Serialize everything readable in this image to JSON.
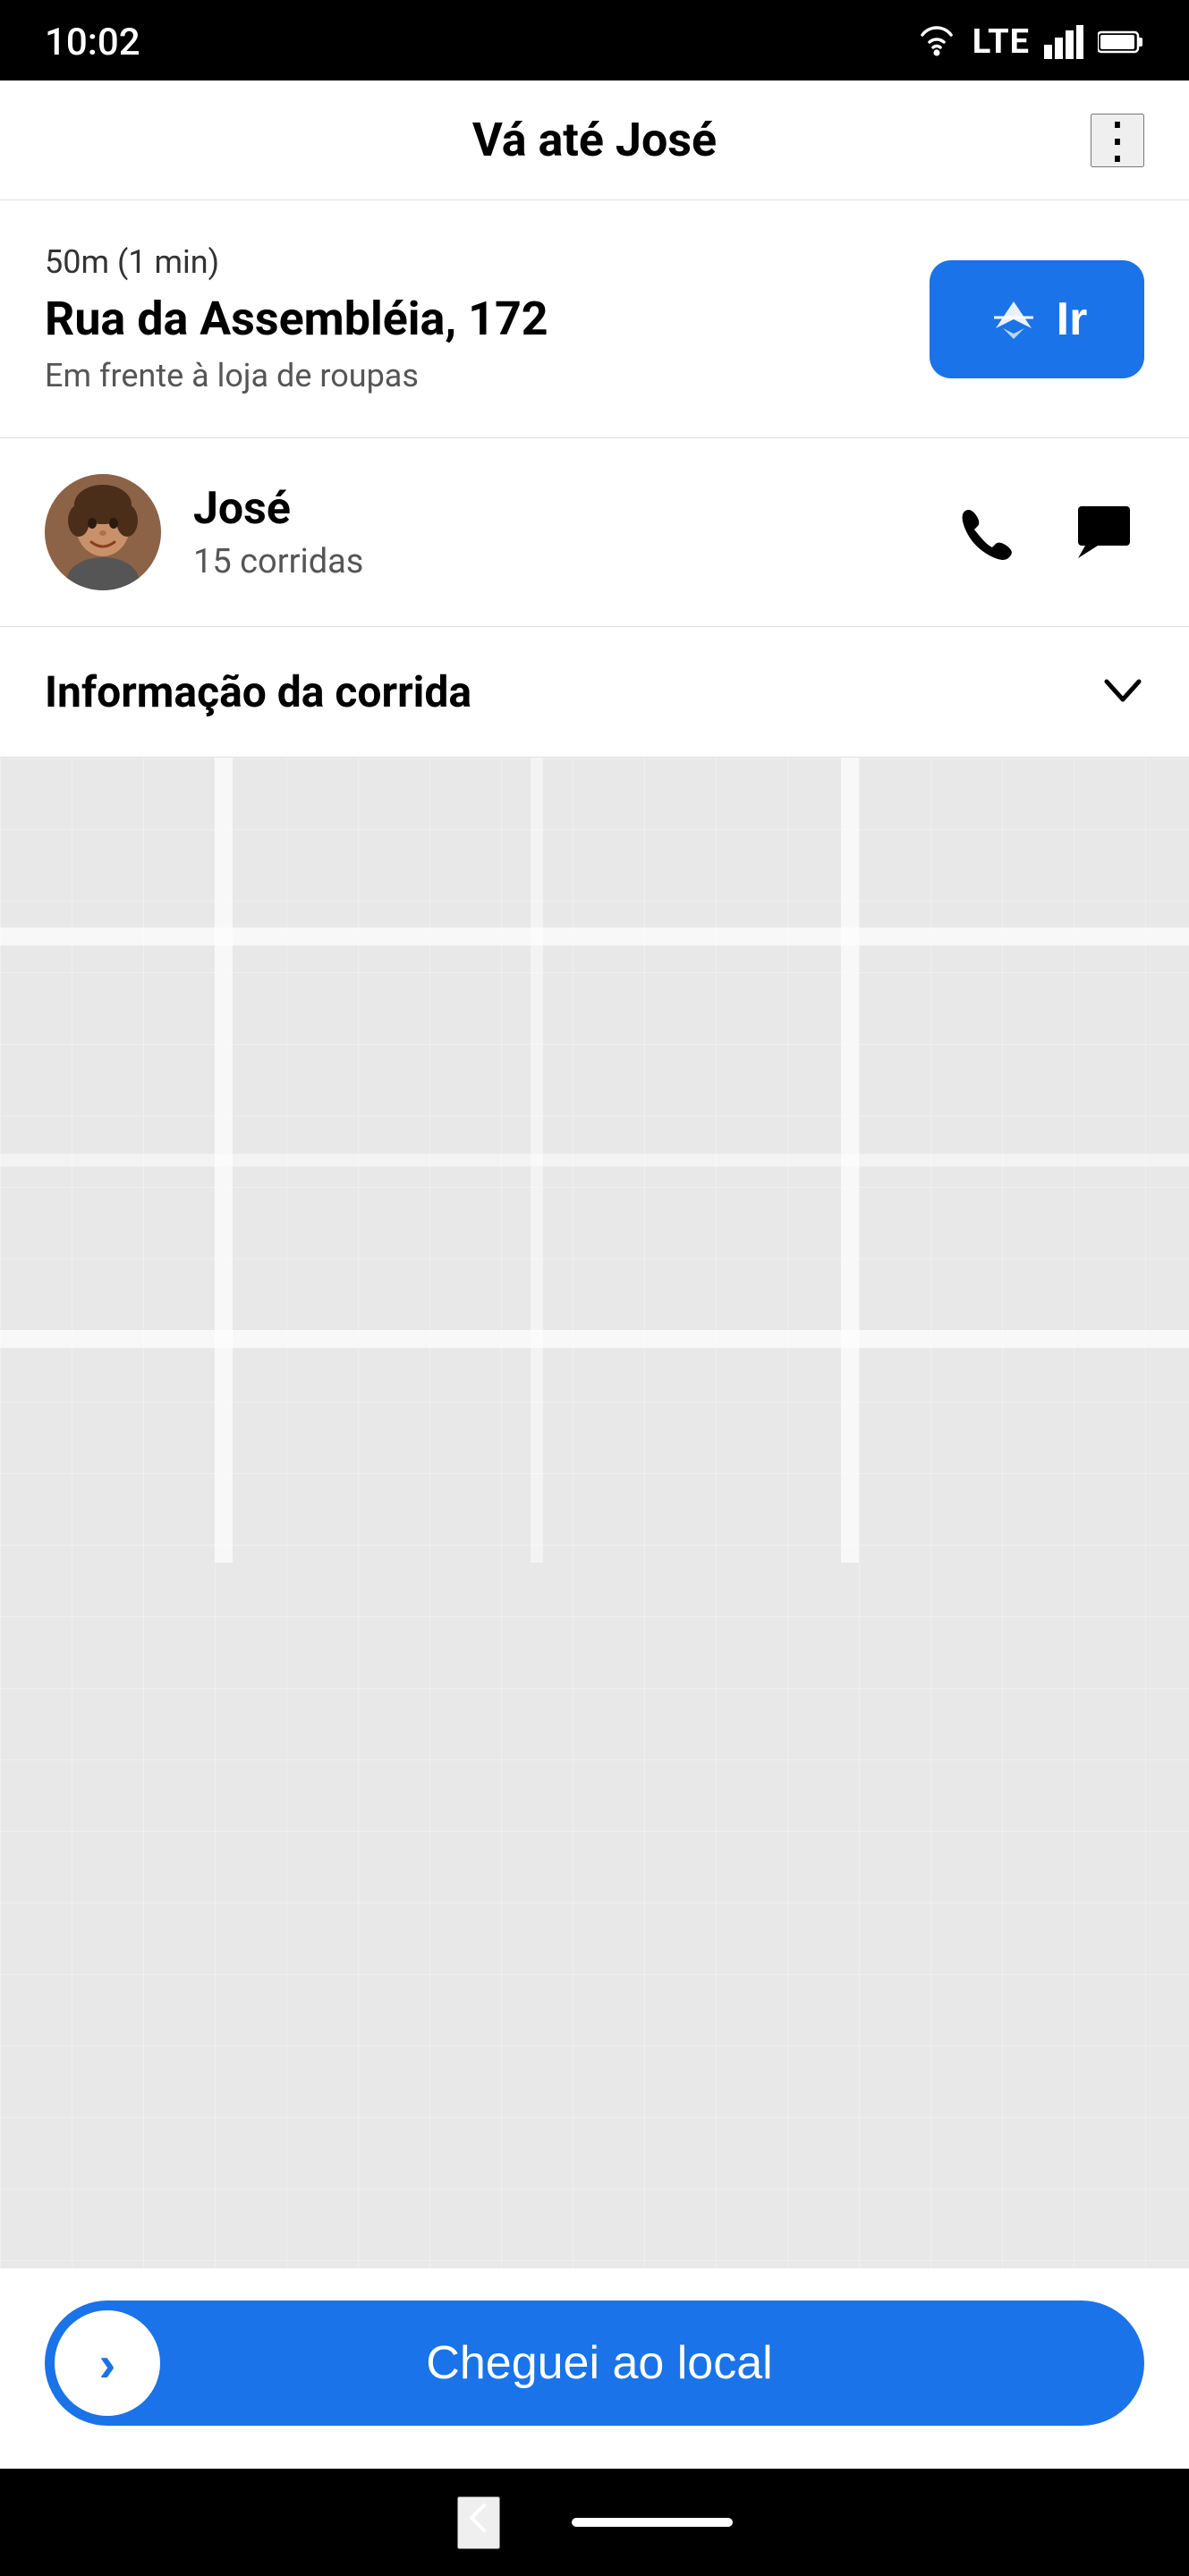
{
  "status_bar": {
    "time": "10:02",
    "network": "LTE"
  },
  "header": {
    "title": "Vá até José",
    "menu_label": "⋮"
  },
  "address_section": {
    "distance": "50m (1 min)",
    "street": "Rua da Assembléia, 172",
    "note": "Em frente à loja de roupas",
    "go_button_label": "Ir"
  },
  "driver_section": {
    "name": "José",
    "rides_label": "15 corridas",
    "phone_action_label": "Ligar",
    "chat_action_label": "Mensagem"
  },
  "ride_info": {
    "label": "Informação da corrida",
    "chevron": "∨"
  },
  "bottom_button": {
    "label": "Cheguei ao local",
    "chevron": "›"
  },
  "nav": {
    "back_label": "‹"
  }
}
